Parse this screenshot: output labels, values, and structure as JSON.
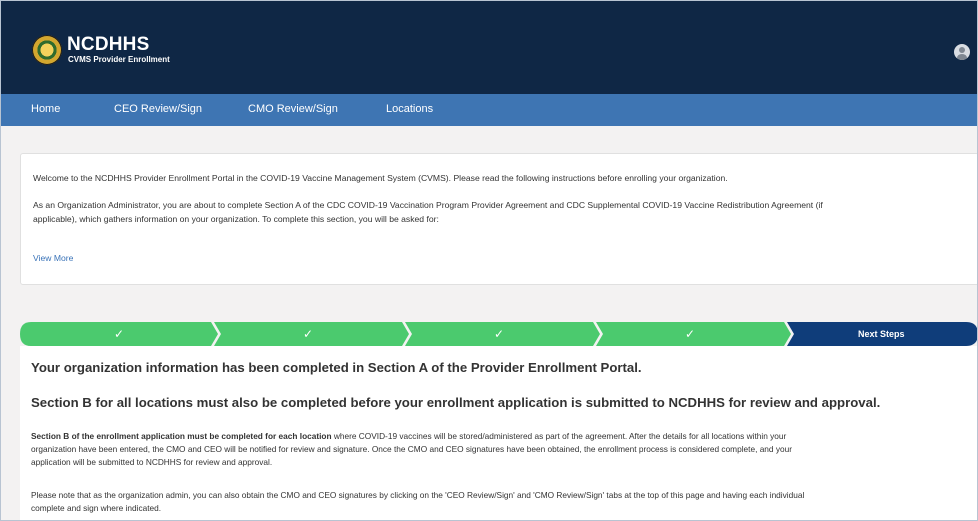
{
  "header": {
    "brand_title": "NCDHHS",
    "brand_subtitle": "CVMS Provider Enrollment",
    "brand_colors": {
      "header_bg": "#0f2745",
      "nav_bg": "#3e75b3"
    }
  },
  "nav": {
    "items": [
      {
        "label": "Home"
      },
      {
        "label": "CEO Review/Sign"
      },
      {
        "label": "CMO Review/Sign"
      },
      {
        "label": "Locations"
      }
    ]
  },
  "intro": {
    "welcome": "Welcome to the NCDHHS Provider Enrollment Portal in the COVID-19 Vaccine Management System (CVMS). Please read the following instructions before enrolling your organization.",
    "admin_line1": "As an Organization Administrator, you are about to complete Section A of the CDC COVID-19 Vaccination Program Provider Agreement and CDC Supplemental COVID-19 Vaccine Redistribution Agreement (if",
    "admin_line2": "applicable), which gathers information on your organization. To complete this section, you will be asked for:",
    "view_more": "View More"
  },
  "stepper": {
    "steps": [
      {
        "state": "complete",
        "icon": "check-icon"
      },
      {
        "state": "complete",
        "icon": "check-icon"
      },
      {
        "state": "complete",
        "icon": "check-icon"
      },
      {
        "state": "complete",
        "icon": "check-icon"
      },
      {
        "state": "current",
        "label": "Next Steps"
      }
    ],
    "check_mark": "✓",
    "colors": {
      "complete": "#4bca6e",
      "current": "#0f3d7a"
    }
  },
  "content": {
    "heading1": "Your organization information has been completed in Section A of the Provider Enrollment Portal.",
    "heading2": "Section B for all locations must also be completed before your enrollment application is submitted to NCDHHS for review and approval.",
    "para1_bold": "Section B of the enrollment application must be completed for each location",
    "para1_line1": " where COVID-19 vaccines will be stored/administered as part of the agreement. After the details for all locations within your",
    "para1_line2": "organization have been entered, the CMO and CEO will be notified for review and signature. Once the CMO and CEO signatures have been obtained, the enrollment process is considered complete, and your",
    "para1_line3": "application will be submitted to NCDHHS for review and approval.",
    "para2_line1": "Please note that as the organization admin, you can also obtain the CMO and CEO signatures by clicking on the 'CEO Review/Sign' and 'CMO Review/Sign' tabs at the top of this page and having each individual",
    "para2_line2": "complete and sign where indicated."
  }
}
